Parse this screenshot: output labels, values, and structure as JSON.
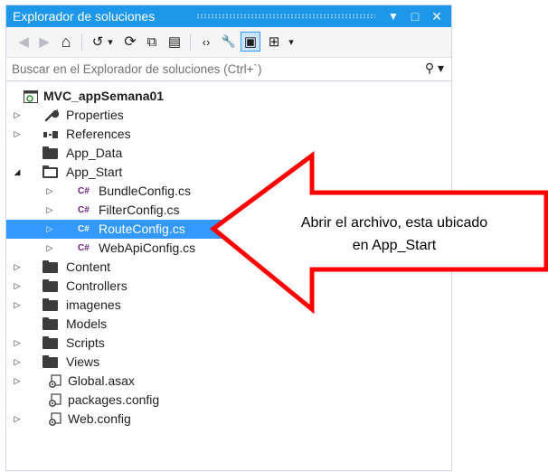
{
  "panel": {
    "title": "Explorador de soluciones",
    "title_buttons": [
      "▼",
      "□",
      "✕"
    ]
  },
  "toolbar": {
    "buttons": [
      {
        "name": "back-icon",
        "glyph": "◀"
      },
      {
        "name": "forward-icon",
        "glyph": "▶"
      },
      {
        "name": "home-icon",
        "glyph": "⌂"
      },
      {
        "name": "history-icon",
        "glyph": "↺"
      },
      {
        "name": "dropdown-icon",
        "glyph": "▾"
      },
      {
        "name": "refresh-icon",
        "glyph": "⟳"
      },
      {
        "name": "collapse-all-icon",
        "glyph": "⧉"
      },
      {
        "name": "show-all-files-icon",
        "glyph": "▤"
      },
      {
        "name": "code-icon",
        "glyph": "‹›"
      },
      {
        "name": "properties-icon",
        "glyph": "🔧"
      },
      {
        "name": "preview-icon",
        "glyph": "▣"
      },
      {
        "name": "diagram-icon",
        "glyph": "⊞"
      },
      {
        "name": "more-dropdown-icon",
        "glyph": "▾"
      }
    ]
  },
  "search": {
    "placeholder": "Buscar en el Explorador de soluciones (Ctrl+`)",
    "icon": "search-icon"
  },
  "tree": {
    "items": [
      {
        "label": "MVC_appSemana01",
        "arrow": "",
        "icon": "project",
        "indent": 0,
        "bold": true
      },
      {
        "label": "Properties",
        "arrow": "▷",
        "icon": "wrench",
        "indent": 0
      },
      {
        "label": "References",
        "arrow": "▷",
        "icon": "references",
        "indent": 0
      },
      {
        "label": "App_Data",
        "arrow": "",
        "icon": "folder",
        "indent": 0
      },
      {
        "label": "App_Start",
        "arrow": "◢",
        "icon": "folder-open",
        "indent": 0
      },
      {
        "label": "BundleConfig.cs",
        "arrow": "▷",
        "icon": "csharp",
        "indent": 1
      },
      {
        "label": "FilterConfig.cs",
        "arrow": "▷",
        "icon": "csharp",
        "indent": 1
      },
      {
        "label": "RouteConfig.cs",
        "arrow": "▷",
        "icon": "csharp",
        "indent": 1,
        "selected": true
      },
      {
        "label": "WebApiConfig.cs",
        "arrow": "▷",
        "icon": "csharp",
        "indent": 1
      },
      {
        "label": "Content",
        "arrow": "▷",
        "icon": "folder",
        "indent": 0
      },
      {
        "label": "Controllers",
        "arrow": "▷",
        "icon": "folder",
        "indent": 0
      },
      {
        "label": "imagenes",
        "arrow": "▷",
        "icon": "folder",
        "indent": 0
      },
      {
        "label": "Models",
        "arrow": "",
        "icon": "folder",
        "indent": 0
      },
      {
        "label": "Scripts",
        "arrow": "▷",
        "icon": "folder",
        "indent": 0
      },
      {
        "label": "Views",
        "arrow": "▷",
        "icon": "folder",
        "indent": 0
      },
      {
        "label": "Global.asax",
        "arrow": "▷",
        "icon": "config",
        "indent": 0
      },
      {
        "label": "packages.config",
        "arrow": "",
        "icon": "config",
        "indent": 0
      },
      {
        "label": "Web.config",
        "arrow": "▷",
        "icon": "config",
        "indent": 0
      }
    ]
  },
  "callout": {
    "line1": "Abrir el archivo, esta ubicado",
    "line2": "en App_Start"
  },
  "colors": {
    "accent": "#1c97ea",
    "selection": "#3399ff",
    "callout_border": "#ff0000"
  }
}
